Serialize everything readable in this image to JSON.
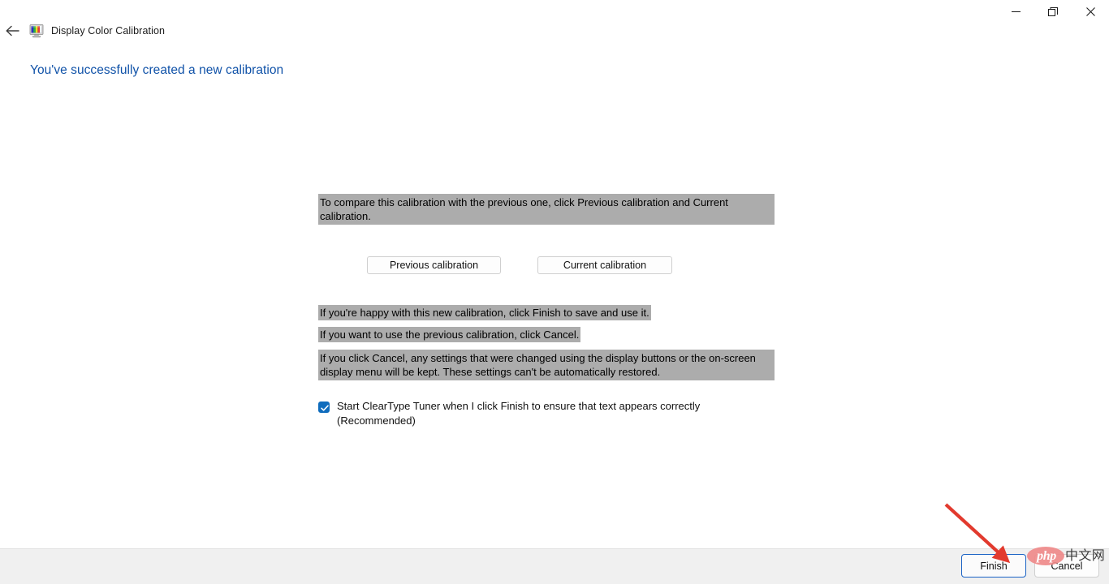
{
  "window": {
    "app_title": "Display Color Calibration",
    "app_icon": "display-color-calibration-icon",
    "back_icon": "back-arrow-icon",
    "controls": {
      "minimize": "minimize-icon",
      "maximize": "restore-icon",
      "close": "close-icon"
    }
  },
  "page": {
    "heading": "You've successfully created a new calibration"
  },
  "main": {
    "intro_text": "To compare this calibration with the previous one, click Previous calibration and Current calibration.",
    "buttons": {
      "previous": "Previous calibration",
      "current": "Current calibration"
    },
    "lines": [
      "If you're happy with this new calibration, click Finish to save and use it.",
      "If you want to use the previous calibration, click Cancel.",
      "If you click Cancel, any settings that were changed using the display buttons or the on-screen display menu will be kept. These settings can't be automatically restored."
    ],
    "checkbox": {
      "checked": true,
      "label": "Start ClearType Tuner when I click Finish to ensure that text appears correctly (Recommended)"
    }
  },
  "footer": {
    "finish_label": "Finish",
    "cancel_label": "Cancel"
  },
  "annotation": {
    "arrow": "red-arrow-pointing-to-finish"
  },
  "watermark": {
    "php": "php",
    "cn": "中文网"
  },
  "colors": {
    "heading_blue": "#1052a8",
    "highlight_gray": "#acacac",
    "focus_blue": "#1a62c4",
    "checkbox_blue": "#0f6cbd",
    "annotation_red": "#e23a2e",
    "footer_bg": "#f0f0f0"
  }
}
